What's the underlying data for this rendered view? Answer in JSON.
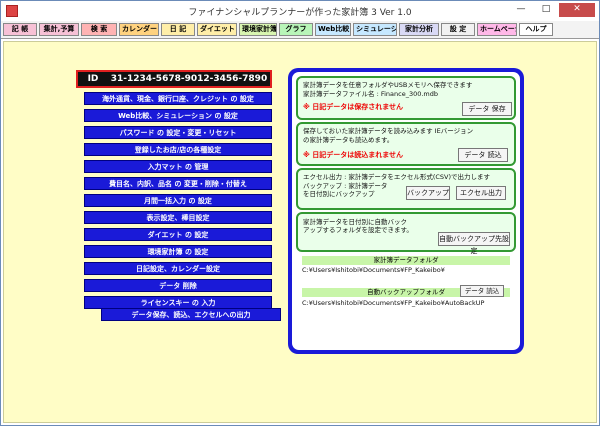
{
  "window": {
    "title": "ファイナンシャルプランナーが作った家計簿 3 Ver 1.0"
  },
  "toolbar": [
    {
      "label": "記 帳",
      "bg": "#f7c1d6"
    },
    {
      "label": "集計,予算",
      "bg": "#f7c1d6"
    },
    {
      "label": "検 索",
      "bg": "#ffb3b3"
    },
    {
      "label": "カレンダー",
      "bg": "#ffd27f"
    },
    {
      "label": "日 記",
      "bg": "#ffeea8"
    },
    {
      "label": "ダイエット",
      "bg": "#ffeea8"
    },
    {
      "label": "環境家計簿",
      "bg": "#d8f5b0"
    },
    {
      "label": "グラフ",
      "bg": "#b8f5b8"
    },
    {
      "label": "Web比較",
      "bg": "#c6e8ff"
    },
    {
      "label": "シミュレーション",
      "bg": "#c6e8ff"
    },
    {
      "label": "家計分析",
      "bg": "#d9d9f5"
    },
    {
      "label": "設 定",
      "bg": "#f1f1f1"
    },
    {
      "label": "ホームページ",
      "bg": "#ffb8e8"
    },
    {
      "label": "ヘルプ",
      "bg": "#ffffff"
    }
  ],
  "id": {
    "label": "ID",
    "value": "31-1234-5678-9012-3456-7890"
  },
  "menu": [
    "海外通貨、現金、銀行口座、クレジット の 設定",
    "Web比較、シミュレーション の 設定",
    "パスワード の 設定・変更・リセット",
    "登録したお店/店の各種設定",
    "入力マット の 管理",
    "費目名、内訳、品名 の 変更・削除・付替え",
    "月間一括入力 の 設定",
    "表示設定、棒目設定",
    "ダイエット の 設定",
    "環境家計簿 の 設定",
    "日記設定、カレンダー設定",
    "データ 削除",
    "ライセンスキー の 入力"
  ],
  "menu_active": "データ保存、読込、エクセルへの出力",
  "save": {
    "line1": "家計簿データを任意フォルダやUSBメモリへ保存できます",
    "line2": "家計簿データファイル名 : Finance_300.mdb",
    "warn": "※ 日記データは保存されません",
    "button": "データ 保存"
  },
  "load": {
    "line1": "保存しておいた家計簿データを読み込みます IEバージョン",
    "line2": "の家計簿データも読込めます。",
    "warn": "※ 日記データは読込まれません",
    "button": "データ 読込"
  },
  "excel": {
    "line1": "エクセル出力 : 家計簿データをエクセル形式(CSV)で出力します",
    "line2": "バックアップ : 家計簿データ",
    "line3": "を日付別にバックアップ",
    "backup_button": "バックアップ",
    "excel_button": "エクセル出力"
  },
  "auto": {
    "line1": "家計簿データを日付別に自動バック",
    "line2": "アップするフォルダを設定できます。",
    "button": "自動バックアップ先設定"
  },
  "folders": {
    "data_label": "家計簿データフォルダ",
    "data_path": "C:¥Users¥Ishitobi¥Documents¥FP_Kakeibo¥",
    "backup_label": "自動バックアップフォルダ",
    "backup_button": "データ 読込",
    "backup_path": "C:¥Users¥Ishitobi¥Documents¥FP_Kakeibo¥AutoBackUP"
  }
}
